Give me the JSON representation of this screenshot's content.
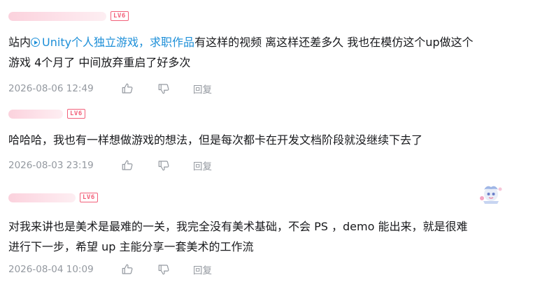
{
  "comments": [
    {
      "level": "LV6",
      "content_prefix": "站内",
      "link_text": "Unity个人独立游戏，求职作品",
      "content_line1_rest": "有这样的视频 离这样还差多久 我也在模仿这个up做这个",
      "content_line2": "游戏 4个月了 中间放弃重启了好多次",
      "time": "2026-08-06 12:49",
      "reply_label": "回复"
    },
    {
      "level": "LV6",
      "content_line1": "哈哈哈，我也有一样想做游戏的想法，但是每次都卡在开发文档阶段就没继续下去了",
      "time": "2026-08-03 23:19",
      "reply_label": "回复"
    },
    {
      "level": "LV6",
      "content_line1": "对我来讲也是美术是最难的一关，我完全没有美术基础，不会 PS ，demo 能出来，就是很难",
      "content_line2": "进行下一步，希望 up 主能分享一套美术的工作流",
      "time": "2026-08-04 10:09",
      "reply_label": "回复"
    }
  ],
  "icons": {
    "like": "thumbs-up-icon",
    "dislike": "thumbs-down-icon",
    "link": "play-circle-icon"
  },
  "colors": {
    "link": "#1d8fd8",
    "level_badge": "#f2607a",
    "meta_text": "#9499a0",
    "body_text": "#18191c"
  }
}
